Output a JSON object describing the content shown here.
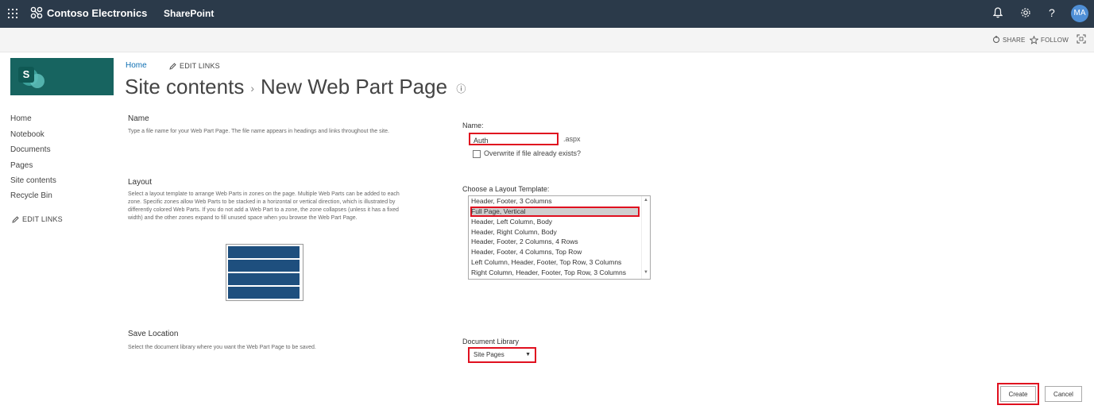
{
  "suite_bar": {
    "org_name": "Contoso Electronics",
    "app_name": "SharePoint",
    "avatar_initials": "MA",
    "help_glyph": "?",
    "icons": [
      "app-launcher-icon",
      "bell-icon",
      "gear-icon",
      "help-icon"
    ]
  },
  "share_bar": {
    "share_label": "SHARE",
    "follow_label": "FOLLOW"
  },
  "breadcrumb": {
    "home": "Home",
    "edit_links": "EDIT LINKS"
  },
  "title": {
    "parent": "Site contents",
    "separator": "›",
    "current": "New Web Part Page",
    "info_glyph": "ⓘ"
  },
  "left_nav": {
    "items": [
      "Home",
      "Notebook",
      "Documents",
      "Pages",
      "Site contents",
      "Recycle Bin"
    ],
    "edit_links": "EDIT LINKS"
  },
  "sections": {
    "name": {
      "heading": "Name",
      "description": "Type a file name for your Web Part Page.  The file name appears in headings and links throughout the site.",
      "field_label": "Name:",
      "value": "Auth",
      "extension": ".aspx",
      "overwrite_label": "Overwrite if file already exists?"
    },
    "layout": {
      "heading": "Layout",
      "description": "Select a layout template to arrange Web Parts in zones on the page. Multiple Web Parts can be added to each zone. Specific zones allow Web Parts to be stacked in a horizontal or vertical direction, which is illustrated by differently colored Web Parts. If you do not add a Web Part to a zone, the zone collapses (unless it has a fixed width) and the other zones expand to fill unused space when you browse the Web Part Page.",
      "field_label": "Choose a Layout Template:",
      "options": [
        "Header, Footer, 3 Columns",
        "Full Page, Vertical",
        "Header, Left Column, Body",
        "Header, Right Column, Body",
        "Header, Footer, 2 Columns, 4 Rows",
        "Header, Footer, 4 Columns, Top Row",
        "Left Column, Header, Footer, Top Row, 3 Columns",
        "Right Column, Header, Footer, Top Row, 3 Columns"
      ],
      "selected": "Full Page, Vertical"
    },
    "save_location": {
      "heading": "Save Location",
      "description": "Select the document library where you want the Web Part Page to be saved.",
      "field_label": "Document Library",
      "selected": "Site Pages"
    }
  },
  "buttons": {
    "create": "Create",
    "cancel": "Cancel"
  },
  "colors": {
    "suite_bar": "#2b3a4a",
    "logo_tile": "#176460",
    "highlight": "#e0101f",
    "layout_preview": "#1e4f7e",
    "link": "#0e6fb3"
  }
}
